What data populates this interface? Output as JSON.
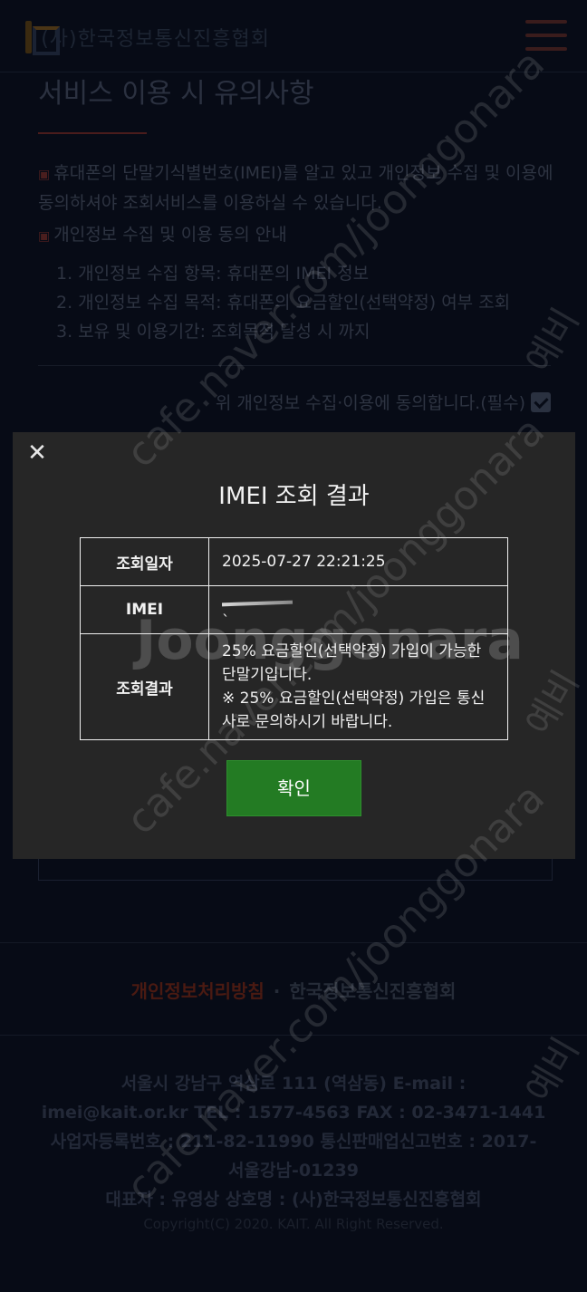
{
  "header": {
    "logo_text": "(사)한국정보통신진흥협회"
  },
  "notice": {
    "title": "서비스 이용 시 유의사항",
    "bullet1": "휴대폰의 단말기식별번호(IMEI)를 알고 있고 개인정보 수집 및 이용에 동의하셔야 조회서비스를 이용하실 수 있습니다.",
    "bullet2": "개인정보 수집 및 이용 동의 안내",
    "items": [
      "1. 개인정보 수집 항목: 휴대폰의 IMEI 정보",
      "2. 개인정보 수집 목적: 휴대폰의 요금할인(선택약정) 여부 조회",
      "3. 보유 및 이용기간: 조회목적 달성 시 까지"
    ],
    "agree_label": "위 개인정보 수집·이용에 동의합니다.(필수)"
  },
  "modal": {
    "close_glyph": "✕",
    "title": "IMEI 조회 결과",
    "rows": {
      "date_label": "조회일자",
      "date_value": "2025-07-27 22:21:25",
      "imei_label": "IMEI",
      "imei_value": "`",
      "result_label": "조회결과",
      "result_line1": "25% 요금할인(선택약정) 가입이 가능한 단말기입니다.",
      "result_line2": "※ 25% 요금할인(선택약정) 가입은 통신사로 문의하시기 바랍니다."
    },
    "confirm_label": "확인"
  },
  "footer": {
    "privacy_link": "개인정보처리방침",
    "separator": "·",
    "kait_link": "한국정보통신진흥협회",
    "info_lines": [
      "서울시 강남구 역삼로 111 (역삼동)       E-mail :",
      "imei@kait.or.kr     TEL : 1577-4563      FAX : 02-3471-1441",
      "사업자등록번호 : 211-82-11990       통신판매업신고번호 : 2017-",
      "서울강남-01239",
      "대표자 : 유영상       상호명 : (사)한국정보통신진흥협회"
    ],
    "copyright": "Copyright(C) 2020. KAIT. All Right Reserved."
  },
  "watermark": {
    "diagonal": "cafe.naver.com/joonggonara",
    "side": "예비",
    "center": "Joonggonara"
  },
  "colors": {
    "modal_bg": "#262626",
    "confirm_green": "#237b23",
    "page_bg": "#070b16",
    "accent_red": "#4a1c1c"
  }
}
